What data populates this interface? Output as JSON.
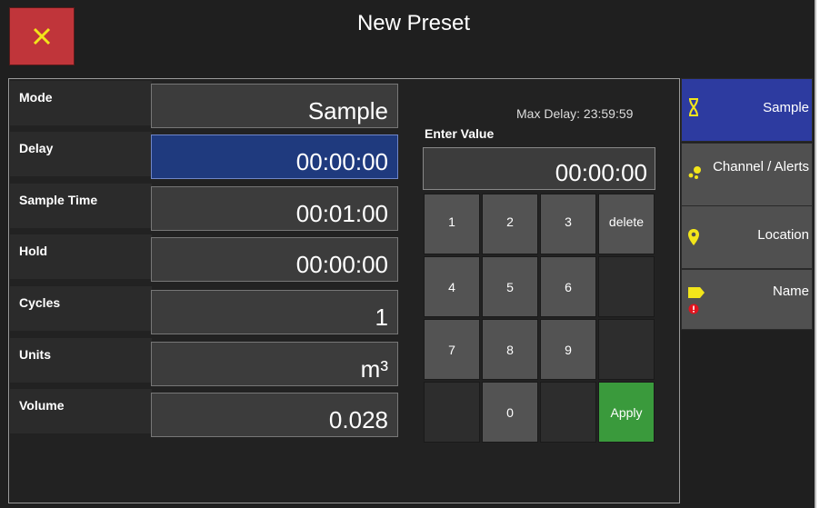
{
  "header": {
    "title": "New Preset",
    "close_icon": "close-icon"
  },
  "fields": [
    {
      "label": "Mode",
      "value": "Sample"
    },
    {
      "label": "Delay",
      "value": "00:00:00"
    },
    {
      "label": "Sample Time",
      "value": "00:01:00"
    },
    {
      "label": "Hold",
      "value": "00:00:00"
    },
    {
      "label": "Cycles",
      "value": "1"
    },
    {
      "label": "Units",
      "value": "m³"
    },
    {
      "label": "Volume",
      "value": "0.028"
    }
  ],
  "keypad": {
    "max_delay": "Max Delay: 23:59:59",
    "enter_label": "Enter Value",
    "entry_value": "00:00:00",
    "keys": {
      "k1": "1",
      "k2": "2",
      "k3": "3",
      "del": "delete",
      "k4": "4",
      "k5": "5",
      "k6": "6",
      "k7": "7",
      "k8": "8",
      "k9": "9",
      "k0": "0",
      "apply": "Apply"
    }
  },
  "sidebar": [
    {
      "label": "Sample",
      "icon": "hourglass-icon",
      "active": true
    },
    {
      "label": "Channel / Alerts",
      "icon": "dots-icon"
    },
    {
      "label": "Location",
      "icon": "location-pin-icon"
    },
    {
      "label": "Name",
      "icon": "tag-icon"
    }
  ],
  "colors": {
    "accent_blue": "#2d3ba0",
    "active_field": "#1f3a7e",
    "apply_green": "#3a9a3c",
    "close_red": "#c0353a",
    "icon_yellow": "#f2e51a",
    "warning_red": "#e0141e"
  }
}
